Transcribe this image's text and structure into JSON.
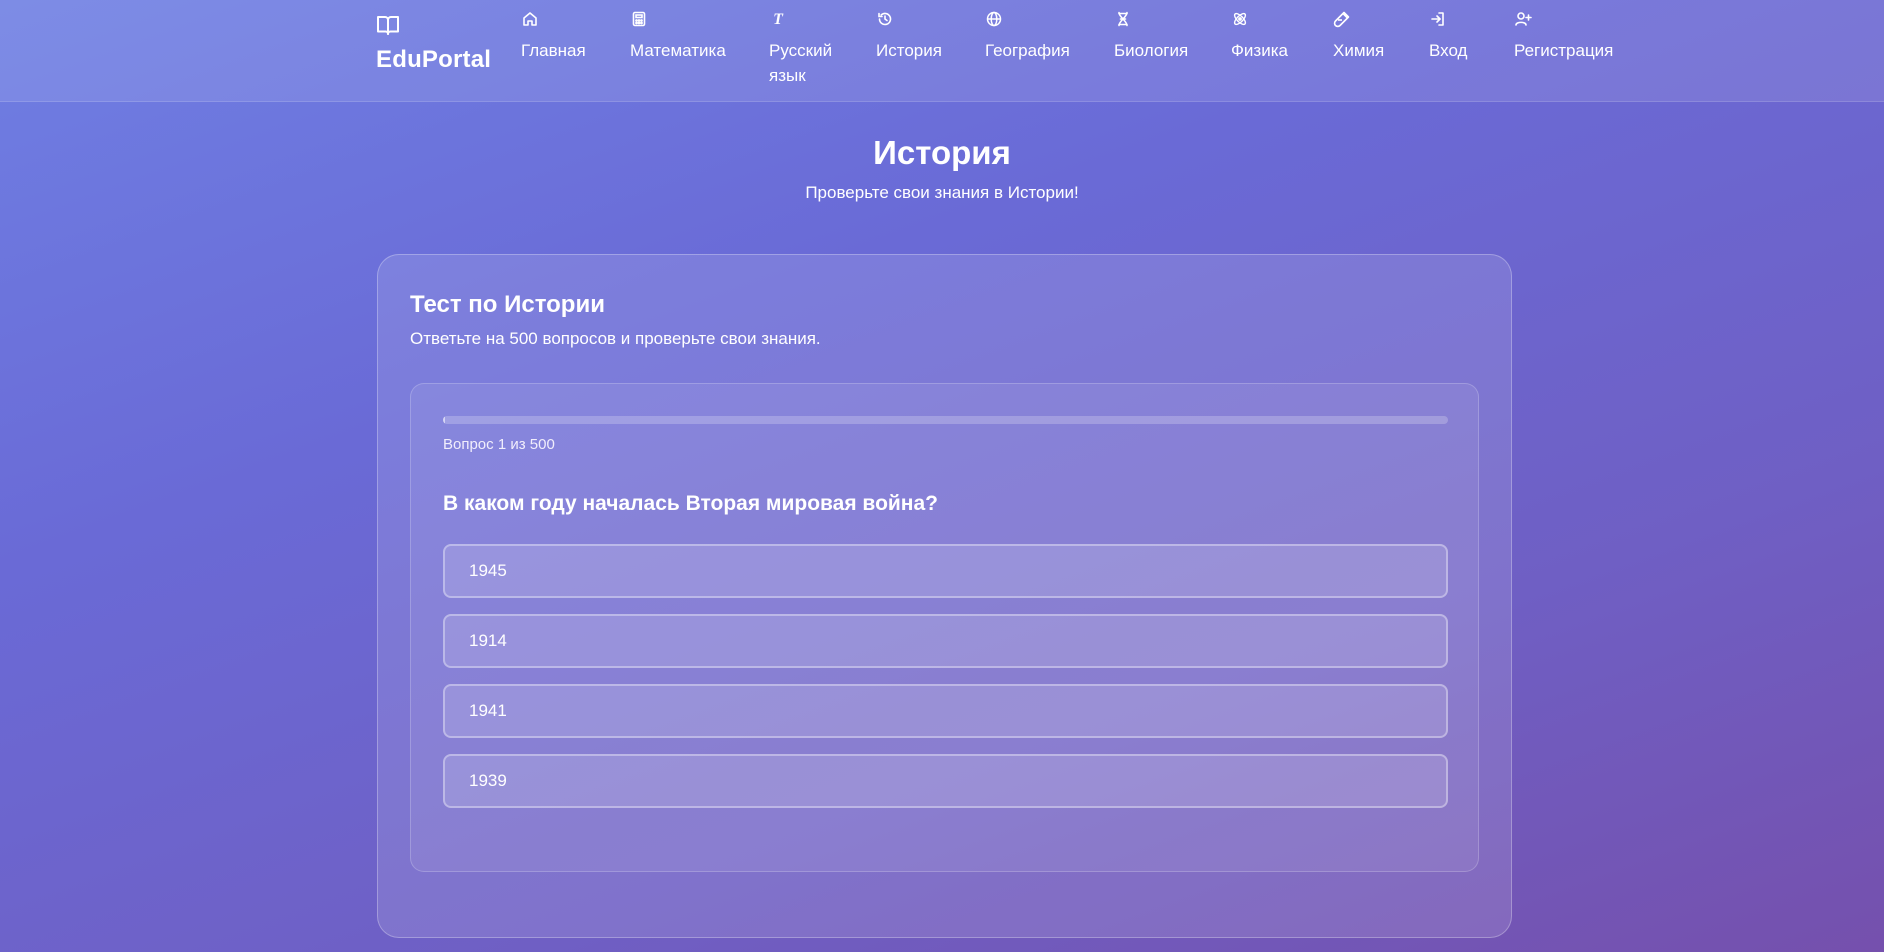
{
  "brand": {
    "name": "EduPortal",
    "icon": "book-open-icon"
  },
  "nav": [
    {
      "label": "Главная",
      "icon": "home-icon"
    },
    {
      "label": "Математика",
      "icon": "calculator-icon"
    },
    {
      "label": "Русский язык",
      "icon": "text-t-icon"
    },
    {
      "label": "История",
      "icon": "history-clock-icon"
    },
    {
      "label": "География",
      "icon": "globe-icon"
    },
    {
      "label": "Биология",
      "icon": "dna-icon"
    },
    {
      "label": "Физика",
      "icon": "atom-icon"
    },
    {
      "label": "Химия",
      "icon": "flask-icon"
    },
    {
      "label": "Вход",
      "icon": "login-icon"
    },
    {
      "label": "Регистрация",
      "icon": "user-plus-icon"
    }
  ],
  "hero": {
    "title": "История",
    "subtitle": "Проверьте свои знания в Истории!"
  },
  "card": {
    "title": "Тест по Истории",
    "subtitle": "Ответьте на 500 вопросов и проверьте свои знания."
  },
  "quiz": {
    "progress_fraction": 0.002,
    "counter": "Вопрос 1 из 500",
    "question": "В каком году началась Вторая мировая война?",
    "answers": [
      "1945",
      "1914",
      "1941",
      "1939"
    ]
  },
  "colors": {
    "background_start": "#6f7fe3",
    "background_end": "#7550ad",
    "text": "#ffffff"
  }
}
